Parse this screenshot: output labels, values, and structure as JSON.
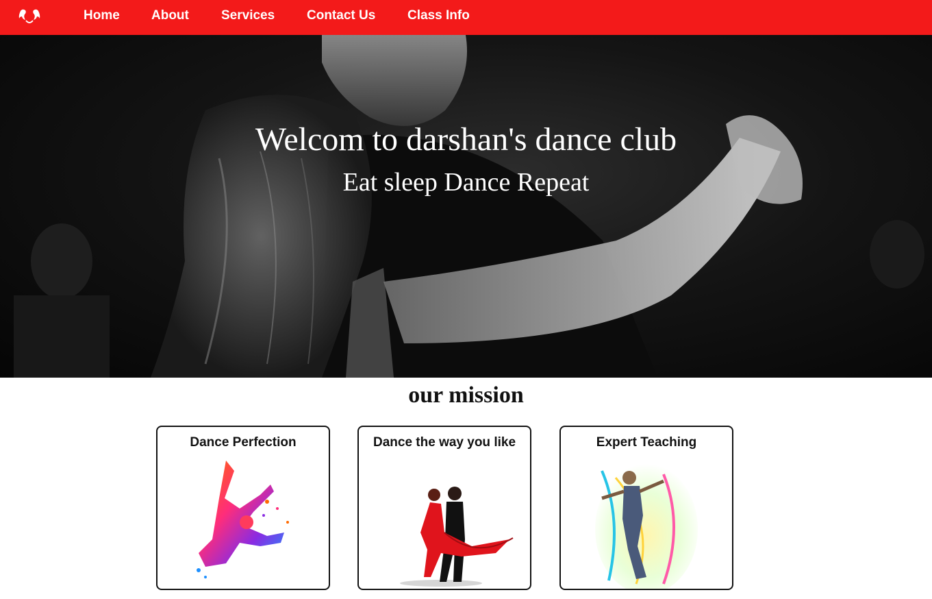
{
  "nav": {
    "logo_icon": "dancers-logo-icon",
    "items": [
      {
        "label": "Home"
      },
      {
        "label": "About"
      },
      {
        "label": "Services"
      },
      {
        "label": "Contact Us"
      },
      {
        "label": "Class Info"
      }
    ],
    "color": "#f31a1a"
  },
  "hero": {
    "title": "Welcom to darshan's dance club",
    "subtitle": "Eat sleep Dance Repeat"
  },
  "mission": {
    "title": "our mission",
    "cards": [
      {
        "title": "Dance Perfection",
        "image": "colorful-dancer-image"
      },
      {
        "title": "Dance the way you like",
        "image": "couple-dancing-image"
      },
      {
        "title": "Expert Teaching",
        "image": "artistic-dancer-image"
      }
    ]
  }
}
